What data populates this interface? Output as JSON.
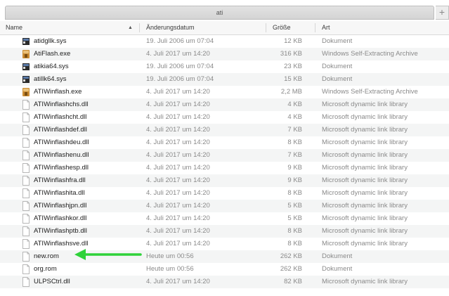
{
  "window": {
    "tab_title": "ati",
    "add_tab": "+"
  },
  "columns": {
    "name": "Name",
    "date": "Änderungsdatum",
    "size": "Größe",
    "kind": "Art"
  },
  "files": [
    {
      "name": "atidgllk.sys",
      "date": "19. Juli 2006 um 07:04",
      "size": "12 KB",
      "kind": "Dokument",
      "icon": "system-file-icon"
    },
    {
      "name": "AtiFlash.exe",
      "date": "4. Juli 2017 um 14:20",
      "size": "316 KB",
      "kind": "Windows Self-Extracting Archive",
      "icon": "archive-exe-icon"
    },
    {
      "name": "atikia64.sys",
      "date": "19. Juli 2006 um 07:04",
      "size": "23 KB",
      "kind": "Dokument",
      "icon": "system-file-icon"
    },
    {
      "name": "atillk64.sys",
      "date": "19. Juli 2006 um 07:04",
      "size": "15 KB",
      "kind": "Dokument",
      "icon": "system-file-icon"
    },
    {
      "name": "ATIWinflash.exe",
      "date": "4. Juli 2017 um 14:20",
      "size": "2,2 MB",
      "kind": "Windows Self-Extracting Archive",
      "icon": "archive-exe-icon"
    },
    {
      "name": "ATIWinflashchs.dll",
      "date": "4. Juli 2017 um 14:20",
      "size": "4 KB",
      "kind": "Microsoft dynamic link library",
      "icon": "document-icon"
    },
    {
      "name": "ATIWinflashcht.dll",
      "date": "4. Juli 2017 um 14:20",
      "size": "4 KB",
      "kind": "Microsoft dynamic link library",
      "icon": "document-icon"
    },
    {
      "name": "ATIWinflashdef.dll",
      "date": "4. Juli 2017 um 14:20",
      "size": "7 KB",
      "kind": "Microsoft dynamic link library",
      "icon": "document-icon"
    },
    {
      "name": "ATIWinflashdeu.dll",
      "date": "4. Juli 2017 um 14:20",
      "size": "8 KB",
      "kind": "Microsoft dynamic link library",
      "icon": "document-icon"
    },
    {
      "name": "ATIWinflashenu.dll",
      "date": "4. Juli 2017 um 14:20",
      "size": "7 KB",
      "kind": "Microsoft dynamic link library",
      "icon": "document-icon"
    },
    {
      "name": "ATIWinflashesp.dll",
      "date": "4. Juli 2017 um 14:20",
      "size": "9 KB",
      "kind": "Microsoft dynamic link library",
      "icon": "document-icon"
    },
    {
      "name": "ATIWinflashfra.dll",
      "date": "4. Juli 2017 um 14:20",
      "size": "9 KB",
      "kind": "Microsoft dynamic link library",
      "icon": "document-icon"
    },
    {
      "name": "ATIWinflashita.dll",
      "date": "4. Juli 2017 um 14:20",
      "size": "8 KB",
      "kind": "Microsoft dynamic link library",
      "icon": "document-icon"
    },
    {
      "name": "ATIWinflashjpn.dll",
      "date": "4. Juli 2017 um 14:20",
      "size": "5 KB",
      "kind": "Microsoft dynamic link library",
      "icon": "document-icon"
    },
    {
      "name": "ATIWinflashkor.dll",
      "date": "4. Juli 2017 um 14:20",
      "size": "5 KB",
      "kind": "Microsoft dynamic link library",
      "icon": "document-icon"
    },
    {
      "name": "ATIWinflashptb.dll",
      "date": "4. Juli 2017 um 14:20",
      "size": "8 KB",
      "kind": "Microsoft dynamic link library",
      "icon": "document-icon"
    },
    {
      "name": "ATIWinflashsve.dll",
      "date": "4. Juli 2017 um 14:20",
      "size": "8 KB",
      "kind": "Microsoft dynamic link library",
      "icon": "document-icon"
    },
    {
      "name": "new.rom",
      "date": "Heute um 00:56",
      "size": "262 KB",
      "kind": "Dokument",
      "icon": "document-icon"
    },
    {
      "name": "org.rom",
      "date": "Heute um 00:56",
      "size": "262 KB",
      "kind": "Dokument",
      "icon": "document-icon"
    },
    {
      "name": "ULPSCtrl.dll",
      "date": "4. Juli 2017 um 14:20",
      "size": "82 KB",
      "kind": "Microsoft dynamic link library",
      "icon": "document-icon"
    }
  ],
  "annotation": {
    "icon": "green-arrow-icon",
    "color": "#2fd23a",
    "points_to": "new.rom"
  },
  "colors": {
    "row_alt": "#f4f5f5",
    "secondary_text": "#8a8a8a"
  }
}
